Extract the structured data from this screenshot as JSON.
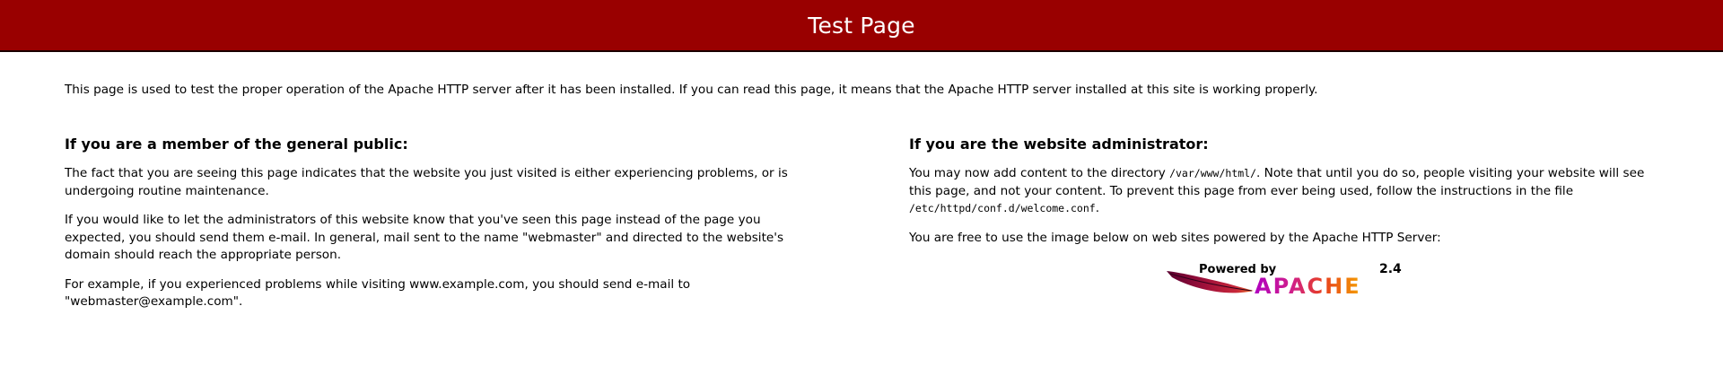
{
  "header": {
    "title": "Test Page"
  },
  "intro": "This page is used to test the proper operation of the Apache HTTP server after it has been installed. If you can read this page, it means that the Apache HTTP server installed at this site is working properly.",
  "public_section": {
    "heading": "If you are a member of the general public:",
    "p1": "The fact that you are seeing this page indicates that the website you just visited is either experiencing problems, or is undergoing routine maintenance.",
    "p2": "If you would like to let the administrators of this website know that you've seen this page instead of the page you expected, you should send them e-mail. In general, mail sent to the name \"webmaster\" and directed to the website's domain should reach the appropriate person.",
    "p3": "For example, if you experienced problems while visiting www.example.com, you should send e-mail to \"webmaster@example.com\"."
  },
  "admin_section": {
    "heading": "If you are the website administrator:",
    "p1_before": "You may now add content to the directory ",
    "p1_path": "/var/www/html/",
    "p1_after": ". Note that until you do so, people visiting your website will see this page, and not your content. To prevent this page from ever being used, follow the instructions in the file ",
    "p1_file": "/etc/httpd/conf.d/welcome.conf",
    "p1_end": ".",
    "p2": "You are free to use the image below on web sites powered by the Apache HTTP Server:"
  },
  "badge": {
    "powered_by": "Powered by",
    "version": "2.4",
    "brand": "APACHE",
    "feather_icon": "apache-feather-icon"
  },
  "colors": {
    "header_bg": "#990000",
    "header_text": "#ffffff"
  }
}
